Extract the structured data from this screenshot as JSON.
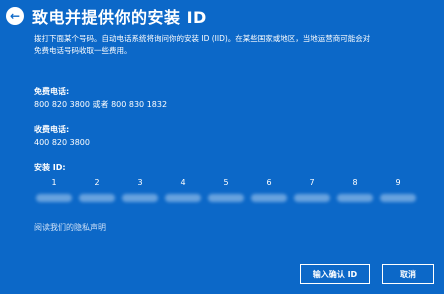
{
  "header": {
    "title": "致电并提供你的安装 ID",
    "back_icon": "arrow-left-icon"
  },
  "intro": {
    "line1": "拨打下面某个号码。自动电话系统将询问你的安装 ID (IID)。在某些国家或地区，当地运营商可能会对",
    "line2": "免费电话号码收取一些费用。"
  },
  "toll_free": {
    "label": "免费电话:",
    "value": "800 820 3800 或者 800 830 1832"
  },
  "toll": {
    "label": "收费电话:",
    "value": "400 820 3800"
  },
  "install_id": {
    "label": "安装 ID:",
    "groups": [
      "1",
      "2",
      "3",
      "4",
      "5",
      "6",
      "7",
      "8",
      "9"
    ]
  },
  "privacy_link": "阅读我们的隐私声明",
  "buttons": {
    "enter_confirmation_id": "输入确认 ID",
    "cancel": "取消"
  },
  "colors": {
    "background": "#0c68c8",
    "text": "#ffffff"
  }
}
